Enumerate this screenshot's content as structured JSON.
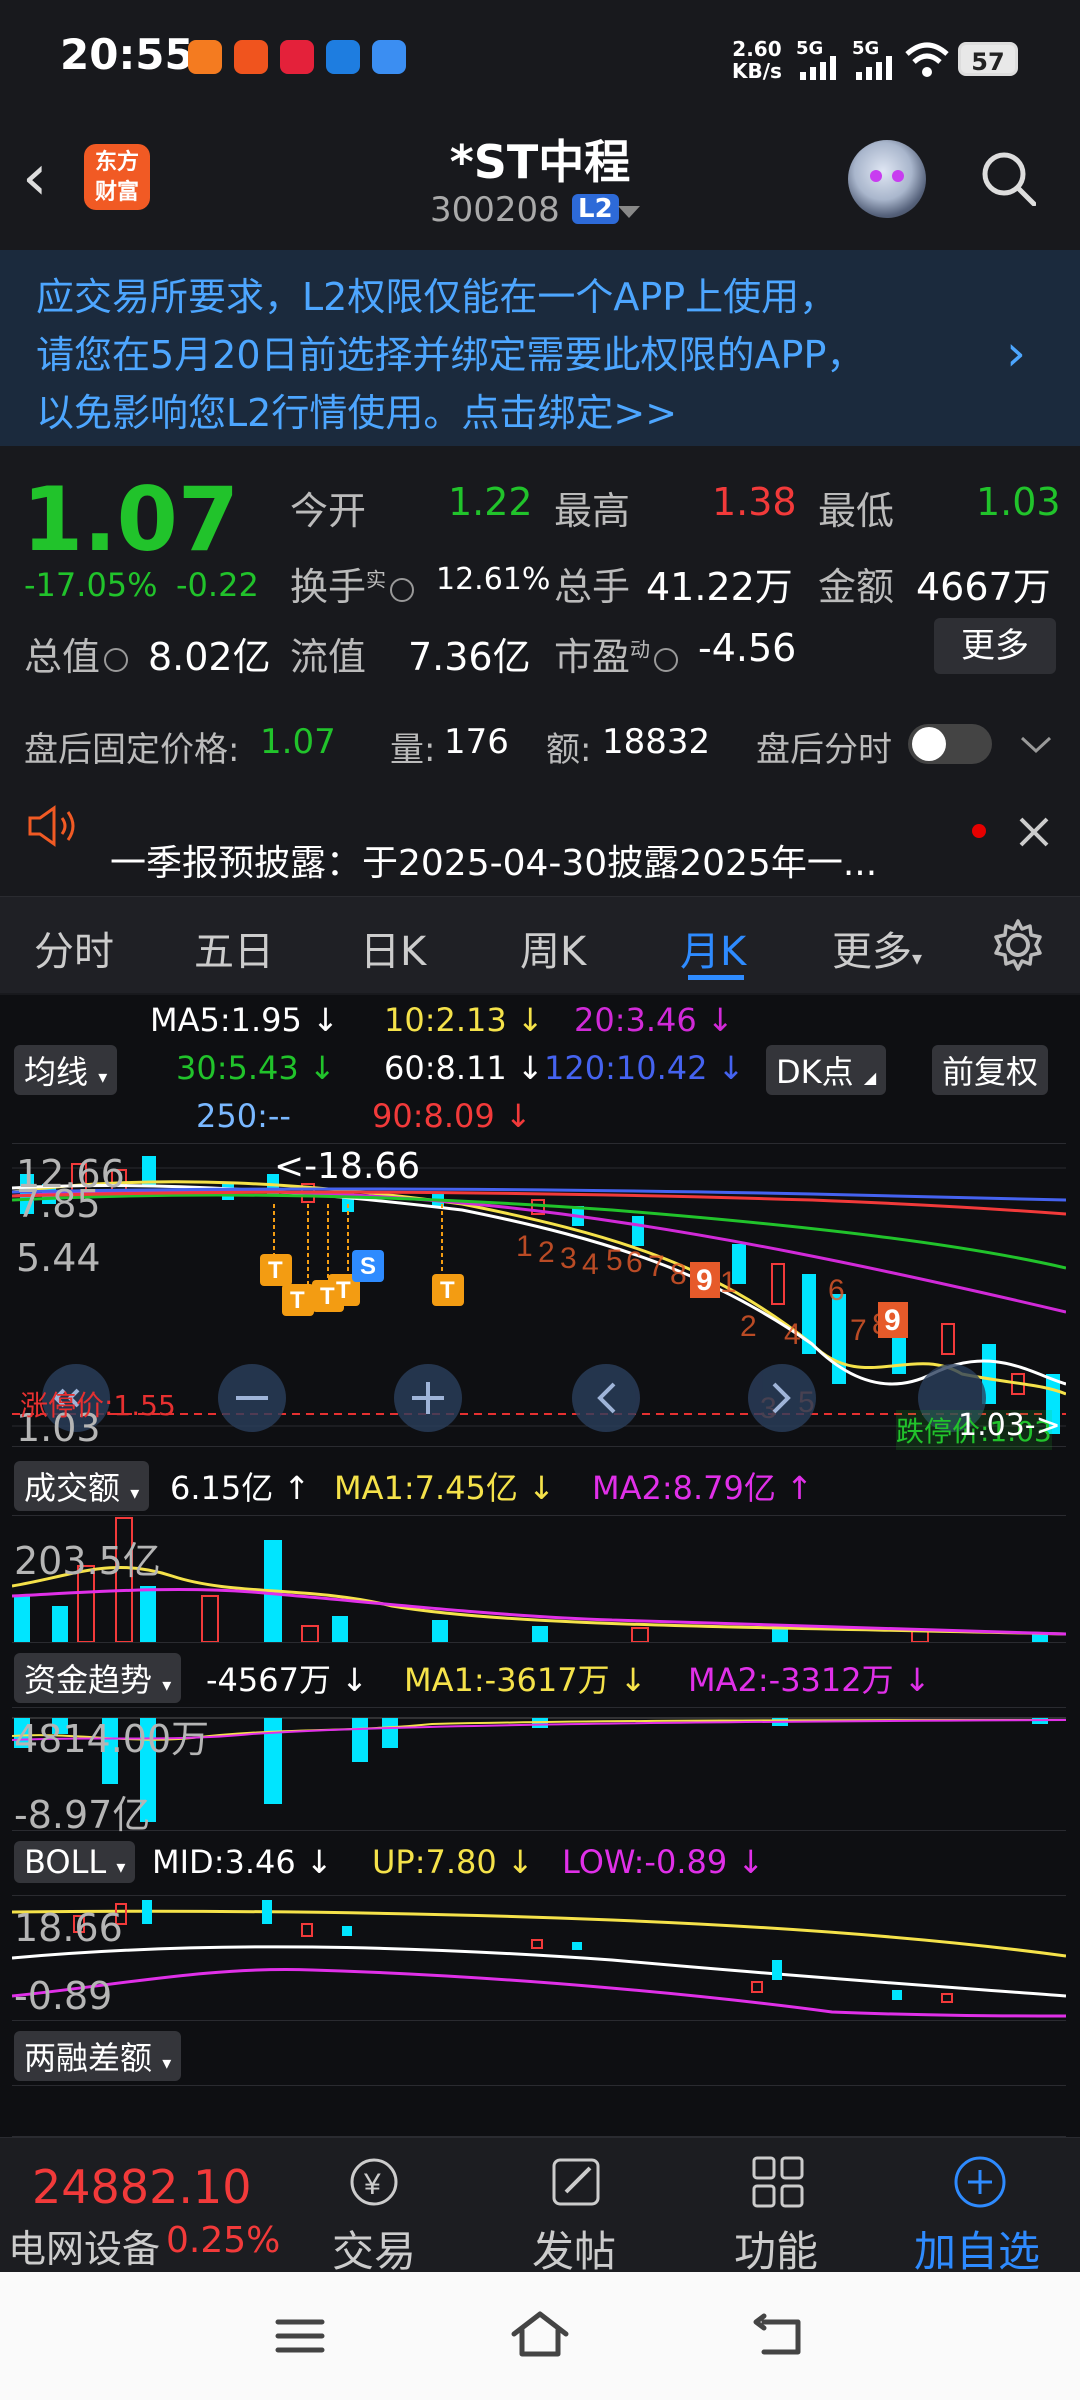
{
  "status_bar": {
    "time": "20:55",
    "net_speed_value": "2.60",
    "net_speed_unit": "KB/s",
    "signal1": "5G",
    "signal2": "5G",
    "battery": "57"
  },
  "header": {
    "brand_line1": "东方",
    "brand_line2": "财富",
    "stock_name": "*ST中程",
    "stock_code": "300208",
    "badge": "L2"
  },
  "notice": {
    "line1": "应交易所要求，L2权限仅能在一个APP上使用，",
    "line2": "请您在5月20日前选择并绑定需要此权限的APP，",
    "line3": "以免影响您L2行情使用。点击绑定>>"
  },
  "quote": {
    "price": "1.07",
    "change_pct": "-17.05%",
    "change_amt": "-0.22",
    "open_label": "今开",
    "open": "1.22",
    "high_label": "最高",
    "high": "1.38",
    "low_label": "最低",
    "low": "1.03",
    "turnover_label": "换手",
    "turnover_sup": "实",
    "turnover": "12.61%",
    "volume_label": "总手",
    "volume": "41.22万",
    "amount_label": "金额",
    "amount": "4667万",
    "mktcap_label": "总值",
    "mktcap": "8.02亿",
    "float_label": "流值",
    "float_cap": "7.36亿",
    "pe_label": "市盈",
    "pe_sup": "动",
    "pe": "-4.56",
    "more_button": "更多"
  },
  "after_hours": {
    "fixed_price_label": "盘后固定价格:",
    "fixed_price": "1.07",
    "vol_label": "量:",
    "vol": "176",
    "amt_label": "额:",
    "amt": "18832",
    "timeshare_label": "盘后分时"
  },
  "announcement": {
    "text": "一季报预披露：于2025-04-30披露2025年一..."
  },
  "tabs": [
    "分时",
    "五日",
    "日K",
    "周K",
    "月K",
    "更多"
  ],
  "chart": {
    "ma_label": "均线",
    "ma5": "MA5:1.95 ↓",
    "ma10": "10:2.13 ↓",
    "ma20": "20:3.46 ↓",
    "ma30": "30:5.43 ↓",
    "ma60": "60:8.11 ↓",
    "ma120": "120:10.42 ↓",
    "ma250": "250:--",
    "ma90": "90:8.09 ↓",
    "dk_button": "DK点",
    "adjust_button": "前复权",
    "y_top": "12.66",
    "y_mid1": "7.85",
    "y_mid2": "5.44",
    "y_low": "1.03",
    "max_marker": "<-18.66",
    "limit_up": "涨停价:1.55",
    "limit_down": "跌停价:1.03",
    "last_marker": "1.03->",
    "volume_panel": {
      "label": "成交额",
      "value": "6.15亿 ↑",
      "ma1": "MA1:7.45亿 ↓",
      "ma2": "MA2:8.79亿 ↑",
      "axis_top": "203.5亿"
    },
    "fund_panel": {
      "label": "资金趋势",
      "value": "-4567万 ↓",
      "ma1": "MA1:-3617万 ↓",
      "ma2": "MA2:-3312万 ↓",
      "axis_top": "4814.00万",
      "axis_bottom": "-8.97亿"
    },
    "boll_panel": {
      "label": "BOLL",
      "mid": "MID:3.46 ↓",
      "up": "UP:7.80 ↓",
      "low": "LOW:-0.89 ↓",
      "axis_top": "18.66",
      "axis_bottom": "-0.89"
    },
    "margin_panel": {
      "label": "两融差额"
    }
  },
  "bottom_bar": {
    "index_value": "24882.10",
    "index_name": "电网设备",
    "index_change": "0.25%",
    "trade": "交易",
    "post": "发帖",
    "functions": "功能",
    "add_watch": "加自选"
  },
  "colors": {
    "up": "#f23a3a",
    "down": "#21c32b",
    "accent": "#2e8bff",
    "brand": "#f15a24"
  }
}
